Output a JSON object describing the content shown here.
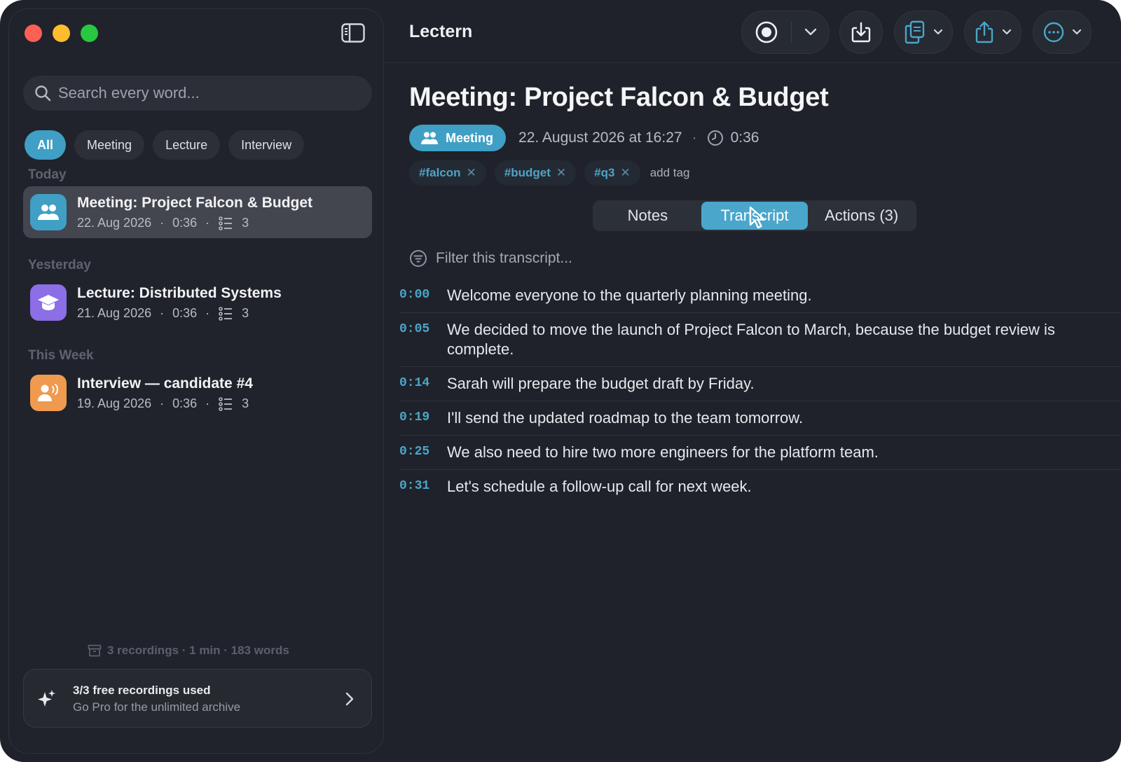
{
  "app": {
    "title": "Lectern"
  },
  "sidebar": {
    "search_placeholder": "Search every word...",
    "filters": [
      {
        "label": "All",
        "active": true
      },
      {
        "label": "Meeting",
        "active": false
      },
      {
        "label": "Lecture",
        "active": false
      },
      {
        "label": "Interview",
        "active": false
      }
    ],
    "sections": [
      {
        "label": "Today",
        "items": [
          {
            "title": "Meeting: Project Falcon & Budget",
            "date": "22. Aug 2026",
            "duration": "0:36",
            "actions": "3",
            "icon": "people-icon",
            "color": "#3f9fc4",
            "selected": true
          }
        ]
      },
      {
        "label": "Yesterday",
        "items": [
          {
            "title": "Lecture: Distributed Systems",
            "date": "21. Aug 2026",
            "duration": "0:36",
            "actions": "3",
            "icon": "graduation-cap-icon",
            "color": "#8c6ee6",
            "selected": false
          }
        ]
      },
      {
        "label": "This Week",
        "items": [
          {
            "title": "Interview — candidate #4",
            "date": "19. Aug 2026",
            "duration": "0:36",
            "actions": "3",
            "icon": "speaking-person-icon",
            "color": "#ef9a4f",
            "selected": false
          }
        ]
      }
    ],
    "stats": "3 recordings · 1 min · 183 words",
    "pro": {
      "title": "3/3 free recordings used",
      "subtitle": "Go Pro for the unlimited archive"
    }
  },
  "recording": {
    "title": "Meeting: Project Falcon & Budget",
    "type": "Meeting",
    "date": "22. August 2026 at 16:27",
    "separator": "·",
    "duration": "0:36",
    "tags": [
      "#falcon",
      "#budget",
      "#q3"
    ],
    "add_tag": "add tag"
  },
  "tabs": [
    {
      "label": "Notes",
      "active": false
    },
    {
      "label": "Transcript",
      "active": true
    },
    {
      "label": "Actions (3)",
      "active": false
    }
  ],
  "transcript": {
    "filter_placeholder": "Filter this transcript...",
    "lines": [
      {
        "time": "0:00",
        "text": "Welcome everyone to the quarterly planning meeting."
      },
      {
        "time": "0:05",
        "text": "We decided to move the launch of Project Falcon to March, because the budget review is complete."
      },
      {
        "time": "0:14",
        "text": "Sarah will prepare the budget draft by Friday."
      },
      {
        "time": "0:19",
        "text": "I'll send the updated roadmap to the team tomorrow."
      },
      {
        "time": "0:25",
        "text": "We also need to hire two more engineers for the platform team."
      },
      {
        "time": "0:31",
        "text": "Let's schedule a follow-up call for next week."
      }
    ]
  },
  "colors": {
    "accent": "#4aa6ca",
    "background": "#1f222a",
    "sidebar": "#20232b"
  }
}
